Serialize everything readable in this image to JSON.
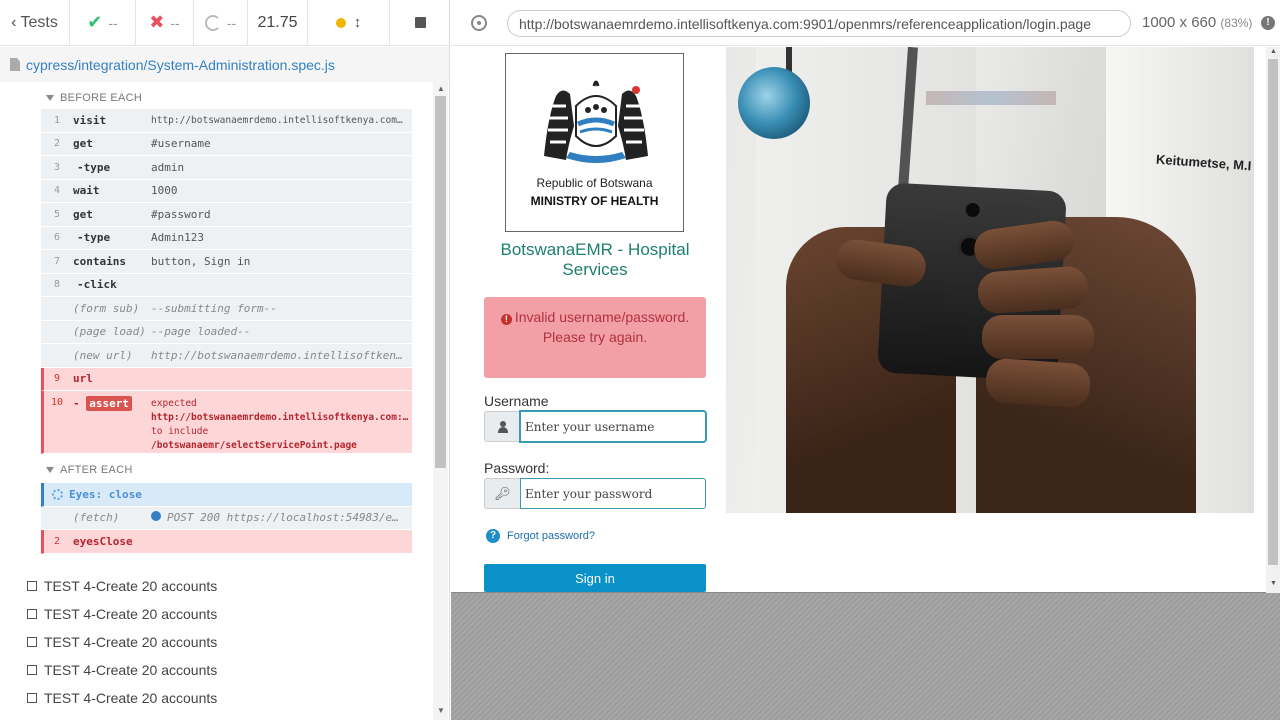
{
  "reporter": {
    "header": {
      "tests_label": "Tests",
      "passed": "--",
      "failed": "--",
      "pending": "--",
      "duration": "21.75"
    },
    "spec_path": "cypress/integration/System-Administration.spec.js",
    "before_each_label": "BEFORE EACH",
    "after_each_label": "AFTER EACH",
    "before_each": [
      {
        "num": "1",
        "name": "visit",
        "msg": "http://botswanaemrdemo.intellisoftkenya.com:…"
      },
      {
        "num": "2",
        "name": "get",
        "msg": "#username"
      },
      {
        "num": "3",
        "name": "-type",
        "msg": "admin"
      },
      {
        "num": "4",
        "name": "wait",
        "msg": "1000"
      },
      {
        "num": "5",
        "name": "get",
        "msg": "#password"
      },
      {
        "num": "6",
        "name": "-type",
        "msg": "Admin123"
      },
      {
        "num": "7",
        "name": "contains",
        "msg": "button, Sign in"
      },
      {
        "num": "8",
        "name": "-click",
        "msg": ""
      },
      {
        "num": "",
        "name": "(form sub)",
        "msg": "--submitting form--"
      },
      {
        "num": "",
        "name": "(page load)",
        "msg": "--page loaded--"
      },
      {
        "num": "",
        "name": "(new url)",
        "msg": "http://botswanaemrdemo.intellisoftken…"
      },
      {
        "num": "9",
        "name": "url",
        "msg": ""
      }
    ],
    "assert_cmd": {
      "num": "10",
      "badge": "assert",
      "expected": "expected",
      "actual": "http://botswanaemrdemo.intellisoftkenya.com:…",
      "to_include": "to include",
      "target": "/botswanaemr/selectServicePoint.page"
    },
    "after_each": [
      {
        "num": "",
        "name": "Eyes: close",
        "msg": ""
      },
      {
        "num": "",
        "name": "(fetch)",
        "msg": "POST 200 https://localhost:54983/e…"
      },
      {
        "num": "2",
        "name": "eyesClose",
        "msg": ""
      }
    ],
    "tests": [
      "TEST 4-Create 20 accounts",
      "TEST 4-Create 20 accounts",
      "TEST 4-Create 20 accounts",
      "TEST 4-Create 20 accounts",
      "TEST 4-Create 20 accounts"
    ]
  },
  "aut": {
    "url": "http://botswanaemrdemo.intellisoftkenya.com:9901/openmrs/referenceapplication/login.page",
    "viewport": "1000 x 660",
    "zoom": "(83%)"
  },
  "login": {
    "logo_line1": "Republic of Botswana",
    "logo_line2": "MINISTRY OF HEALTH",
    "title": "BotswanaEMR - Hospital Services",
    "error": "Invalid username/password. Please try again.",
    "username_label": "Username",
    "username_placeholder": "Enter your username",
    "password_label": "Password:",
    "password_placeholder": "Enter your password",
    "forgot": "Forgot password?",
    "signin": "Sign in",
    "hero_badge": "Keitumetse, M.I"
  },
  "colors": {
    "pass": "#2fbf71",
    "fail": "#e94f5f",
    "accent_blue": "#0a92c8",
    "title_green": "#1d7f6d",
    "alert_bg": "#f2a0a6"
  }
}
